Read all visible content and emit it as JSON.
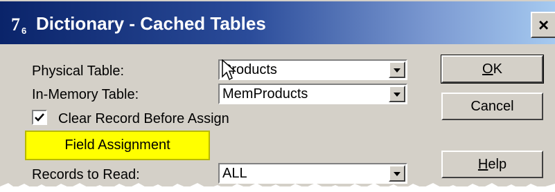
{
  "window": {
    "title": "Dictionary - Cached Tables",
    "app_icon_text": "7",
    "app_icon_sub": "6",
    "close_label": "×"
  },
  "form": {
    "physical_table_label": "Physical Table:",
    "physical_table_value": "Products",
    "in_memory_label": "In-Memory Table:",
    "in_memory_value": "MemProducts",
    "clear_record_label": "Clear Record Before Assign",
    "clear_record_checked": true,
    "field_assignment_label": "Field Assignment",
    "records_label": "Records to Read:",
    "records_value": "ALL"
  },
  "buttons": {
    "ok_mnemonic": "O",
    "ok_rest": "K",
    "cancel_label": "Cancel",
    "help_mnemonic": "H",
    "help_rest": "elp"
  },
  "colors": {
    "titlebar_start": "#0a246a",
    "titlebar_end": "#a6caf0",
    "dialog_face": "#d4d0c8",
    "highlight": "#ffff00"
  }
}
